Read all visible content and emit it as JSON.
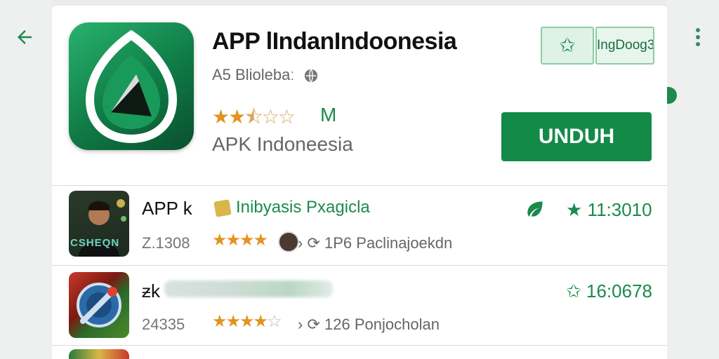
{
  "nav": {
    "back_icon": "arrow-left-icon",
    "more_icon": "more-vert-icon"
  },
  "app": {
    "title": "APP lIndanIndoonesia",
    "developer": "A5 Bliolebaː",
    "stars_filled": 2.5,
    "stars_total": 5,
    "rating_label": "M",
    "subtitle": "APK Indoneesia",
    "chip_label": "IngDoog3",
    "install_label": "UNDUH"
  },
  "list": [
    {
      "thumb_label": "CSHEQN",
      "title": "APP k",
      "category": "Inibyasis Pxagicla",
      "count": "Z.1308",
      "stars": 4,
      "meta": "1P6 Paclinajoekdn",
      "score": "11:3010"
    },
    {
      "title": "ƶk",
      "count": "24335",
      "stars": 4,
      "meta": "126 Ponjocholan",
      "score": "16:0678"
    }
  ],
  "colors": {
    "accent": "#148a48",
    "star": "#e3931f",
    "background": "#e9ecea"
  }
}
